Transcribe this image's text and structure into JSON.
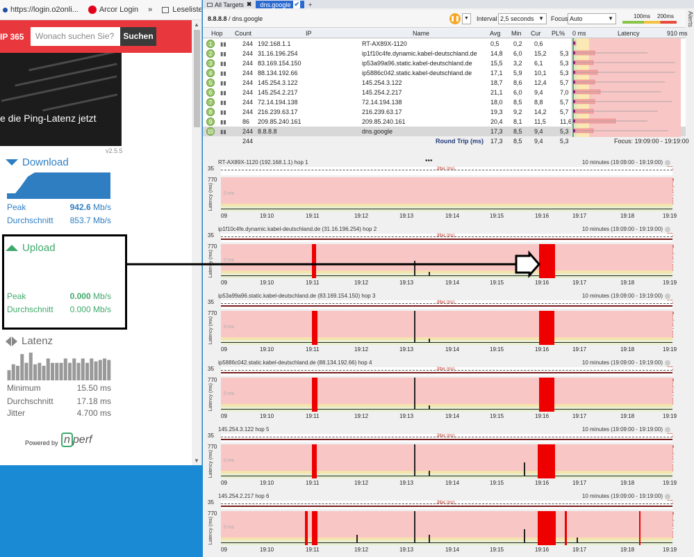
{
  "browser": {
    "bookmarks": [
      {
        "label": "https://login.o2onli...",
        "icon_color": "#1f4fa8"
      },
      {
        "label": "Arcor Login",
        "icon_color": "#e2001a"
      }
    ],
    "more_label": "»",
    "reading_list": "Leseliste",
    "site_brand": "IP 365",
    "search_placeholder": "Wonach suchen Sie?",
    "search_button": "Suchen",
    "hero_text": "e die Ping-Latenz jetzt",
    "version": "v2.5.5",
    "download": {
      "title": "Download",
      "peak_label": "Peak",
      "peak_value": "942.6",
      "avg_label": "Durchschnitt",
      "avg_value": "853.7",
      "unit": "Mb/s"
    },
    "upload": {
      "title": "Upload",
      "peak_label": "Peak",
      "peak_value": "0.000",
      "avg_label": "Durchschnitt",
      "avg_value": "0.000",
      "unit": "Mb/s"
    },
    "latency": {
      "title": "Latenz",
      "min_label": "Minimum",
      "min_value": "15.50 ms",
      "avg_label": "Durchschnitt",
      "avg_value": "17.18 ms",
      "jitter_label": "Jitter",
      "jitter_value": "4.700 ms",
      "bar_heights": [
        0.35,
        0.55,
        0.5,
        0.9,
        0.6,
        0.95,
        0.55,
        0.6,
        0.5,
        0.75,
        0.6,
        0.6,
        0.6,
        0.75,
        0.6,
        0.75,
        0.6,
        0.75,
        0.6,
        0.75,
        0.65,
        0.7,
        0.75,
        0.7
      ]
    },
    "powered_by": "Powered by",
    "logo_text": "nperf"
  },
  "app": {
    "tabs": [
      {
        "label": "All Targets",
        "active": false
      },
      {
        "label": "dns.google",
        "active": true
      }
    ],
    "add_tab": "+",
    "alerts": "Alerts",
    "target": {
      "ip": "8.8.8.8",
      "name": "dns.google"
    },
    "interval_label": "Interval",
    "interval_value": "2,5 seconds",
    "focus_label": "Focus",
    "focus_value": "Auto",
    "legend_100": "100ms",
    "legend_200": "200ms",
    "headers": {
      "hop": "Hop",
      "count": "Count",
      "ip": "IP",
      "name": "Name",
      "avg": "Avg",
      "min": "Min",
      "cur": "Cur",
      "pl": "PL%",
      "zero": "0 ms",
      "latency": "Latency",
      "max": "910 ms"
    },
    "hops": [
      {
        "hop": "1",
        "count": "244",
        "ip": "192.168.1.1",
        "name": "RT-AX89X-1120",
        "avg": "0,5",
        "min": "0,2",
        "cur": "0,6",
        "pl": ""
      },
      {
        "hop": "2",
        "count": "244",
        "ip": "31.16.196.254",
        "name": "ip1f10c4fe.dynamic.kabel-deutschland.de",
        "avg": "14,8",
        "min": "6,0",
        "cur": "15,2",
        "pl": "5,3"
      },
      {
        "hop": "3",
        "count": "244",
        "ip": "83.169.154.150",
        "name": "ip53a99a96.static.kabel-deutschland.de",
        "avg": "15,5",
        "min": "3,2",
        "cur": "6,1",
        "pl": "5,3"
      },
      {
        "hop": "4",
        "count": "244",
        "ip": "88.134.192.66",
        "name": "ip5886c042.static.kabel-deutschland.de",
        "avg": "17,1",
        "min": "5,9",
        "cur": "10,1",
        "pl": "5,3"
      },
      {
        "hop": "5",
        "count": "244",
        "ip": "145.254.3.122",
        "name": "145.254.3.122",
        "avg": "18,7",
        "min": "8,6",
        "cur": "12,4",
        "pl": "5,7"
      },
      {
        "hop": "6",
        "count": "244",
        "ip": "145.254.2.217",
        "name": "145.254.2.217",
        "avg": "21,1",
        "min": "6,0",
        "cur": "9,4",
        "pl": "7,0"
      },
      {
        "hop": "7",
        "count": "244",
        "ip": "72.14.194.138",
        "name": "72.14.194.138",
        "avg": "18,0",
        "min": "8,5",
        "cur": "8,8",
        "pl": "5,7"
      },
      {
        "hop": "8",
        "count": "244",
        "ip": "216.239.63.17",
        "name": "216.239.63.17",
        "avg": "19,3",
        "min": "9,2",
        "cur": "14,2",
        "pl": "5,7"
      },
      {
        "hop": "9",
        "count": "86",
        "ip": "209.85.240.161",
        "name": "209.85.240.161",
        "avg": "20,4",
        "min": "8,1",
        "cur": "11,5",
        "pl": "11,6"
      },
      {
        "hop": "10",
        "count": "244",
        "ip": "8.8.8.8",
        "name": "dns.google",
        "avg": "17,3",
        "min": "8,5",
        "cur": "9,4",
        "pl": "5,3"
      }
    ],
    "totals": {
      "count": "244",
      "label": "Round Trip (ms)",
      "avg": "17,3",
      "min": "8,5",
      "cur": "9,4",
      "pl": "5,3",
      "focus": "Focus: 19:09:00 - 19:19:00"
    },
    "splitter": "•••",
    "panels": [
      {
        "title": "RT-AX89X-1120 (192.168.1.1) hop 1",
        "range": "10 minutes (19:09:00 - 19:19:00)"
      },
      {
        "title": "ip1f10c4fe.dynamic.kabel-deutschland.de (31.16.196.254) hop 2",
        "range": "10 minutes (19:09:00 - 19:19:00)"
      },
      {
        "title": "ip53a99a96.static.kabel-deutschland.de (83.169.154.150) hop 3",
        "range": "10 minutes (19:09:00 - 19:19:00)"
      },
      {
        "title": "ip5886c042.static.kabel-deutschland.de (88.134.192.66) hop 4",
        "range": "10 minutes (19:09:00 - 19:19:00)"
      },
      {
        "title": "145.254.3.122 hop 5",
        "range": "10 minutes (19:09:00 - 19:19:00)"
      },
      {
        "title": "145.254.2.217 hop 6",
        "range": "10 minutes (19:09:00 - 19:19:00)"
      }
    ],
    "graph_labels": {
      "y_max": "770",
      "y_jitter": "35",
      "y_axis": "Latency (ms)",
      "pl_max": "30",
      "pl_axis": "Packet Loss",
      "jitter": "Jitter (ms)",
      "zero": "0 ms",
      "x_ticks": [
        "09",
        "19:10",
        "19:11",
        "19:12",
        "19:13",
        "19:14",
        "19:15",
        "19:16",
        "19:17",
        "19:18",
        "19:19"
      ]
    }
  }
}
